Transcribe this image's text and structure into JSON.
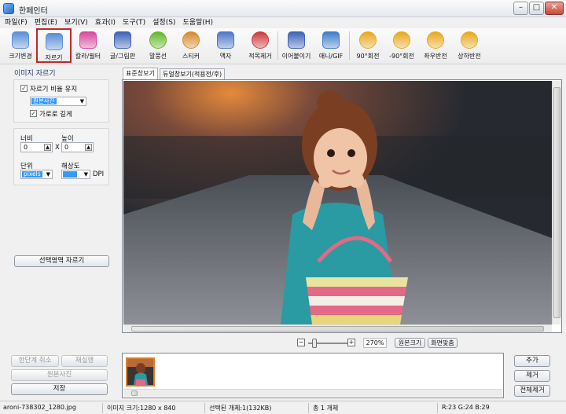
{
  "window": {
    "title": "한페인터",
    "min": "–",
    "max": "□",
    "close": "✕"
  },
  "menu": [
    "파일(F)",
    "편집(E)",
    "보기(V)",
    "효과(I)",
    "도구(T)",
    "설정(S)",
    "도움말(H)"
  ],
  "toolbar": [
    {
      "label": "크기변경",
      "icon": "resize-icon",
      "color": "#5b8fd6"
    },
    {
      "label": "자르기",
      "icon": "crop-icon",
      "color": "#5b8fd6",
      "active": true
    },
    {
      "label": "칼라/필터",
      "icon": "color-filter-icon",
      "color": "#d74b9d"
    },
    {
      "label": "글/그림판",
      "icon": "text-paint-icon",
      "color": "#3f63b8"
    },
    {
      "label": "말풍선",
      "icon": "speech-bubble-icon",
      "color": "#64b82d"
    },
    {
      "label": "스티커",
      "icon": "sticker-icon",
      "color": "#d88a2a"
    },
    {
      "label": "액자",
      "icon": "frame-icon",
      "color": "#4d78c9"
    },
    {
      "label": "적목제거",
      "icon": "red-eye-icon",
      "color": "#cc3b3b"
    },
    {
      "label": "이어붙이기",
      "icon": "merge-icon",
      "color": "#3f63b8"
    },
    {
      "label": "애니/GIF",
      "icon": "gif-icon",
      "color": "#3f7ec9"
    },
    {
      "label": "90°회전",
      "icon": "rotate-cw-icon",
      "color": "#e8a81e"
    },
    {
      "label": "-90°회전",
      "icon": "rotate-ccw-icon",
      "color": "#e8a81e"
    },
    {
      "label": "좌우반전",
      "icon": "flip-horizontal-icon",
      "color": "#e8a81e"
    },
    {
      "label": "상하반전",
      "icon": "flip-vertical-icon",
      "color": "#e8a81e"
    }
  ],
  "panel": {
    "title": "이미지 자르기",
    "keep_ratio": "자르기 비율 유지",
    "ratio_value": "원본사진",
    "long_side": "가로로 길게",
    "width_label": "너비",
    "height_label": "높이",
    "width_value": "0",
    "height_value": "0",
    "x": "X",
    "unit_label": "단위",
    "unit_value": "pixels",
    "res_label": "해상도",
    "res_value": "",
    "dpi": "DPI",
    "crop_button": "선택영역 자르기",
    "undo": "한단계 취소",
    "redo": "재실행",
    "original": "원본사진",
    "save": "저장"
  },
  "tabs": [
    "표준창보기",
    "듀얼창보기(적용전/후)"
  ],
  "zoom": {
    "minus": "−",
    "plus": "+",
    "percent": "270%",
    "original_size": "원본크기",
    "fit_screen": "화면맞춤",
    "slider_level": 0.15
  },
  "file_buttons": {
    "add": "추가",
    "remove": "제거",
    "remove_all": "전체제거"
  },
  "status": {
    "filename": "aroni-738302_1280.jpg",
    "image_size": "이미지 크기:1280 x 840",
    "selected": "선택된 개체:1(132KB)",
    "total": "총 1 개체",
    "rgb": "R:23 G:24 B:29"
  }
}
